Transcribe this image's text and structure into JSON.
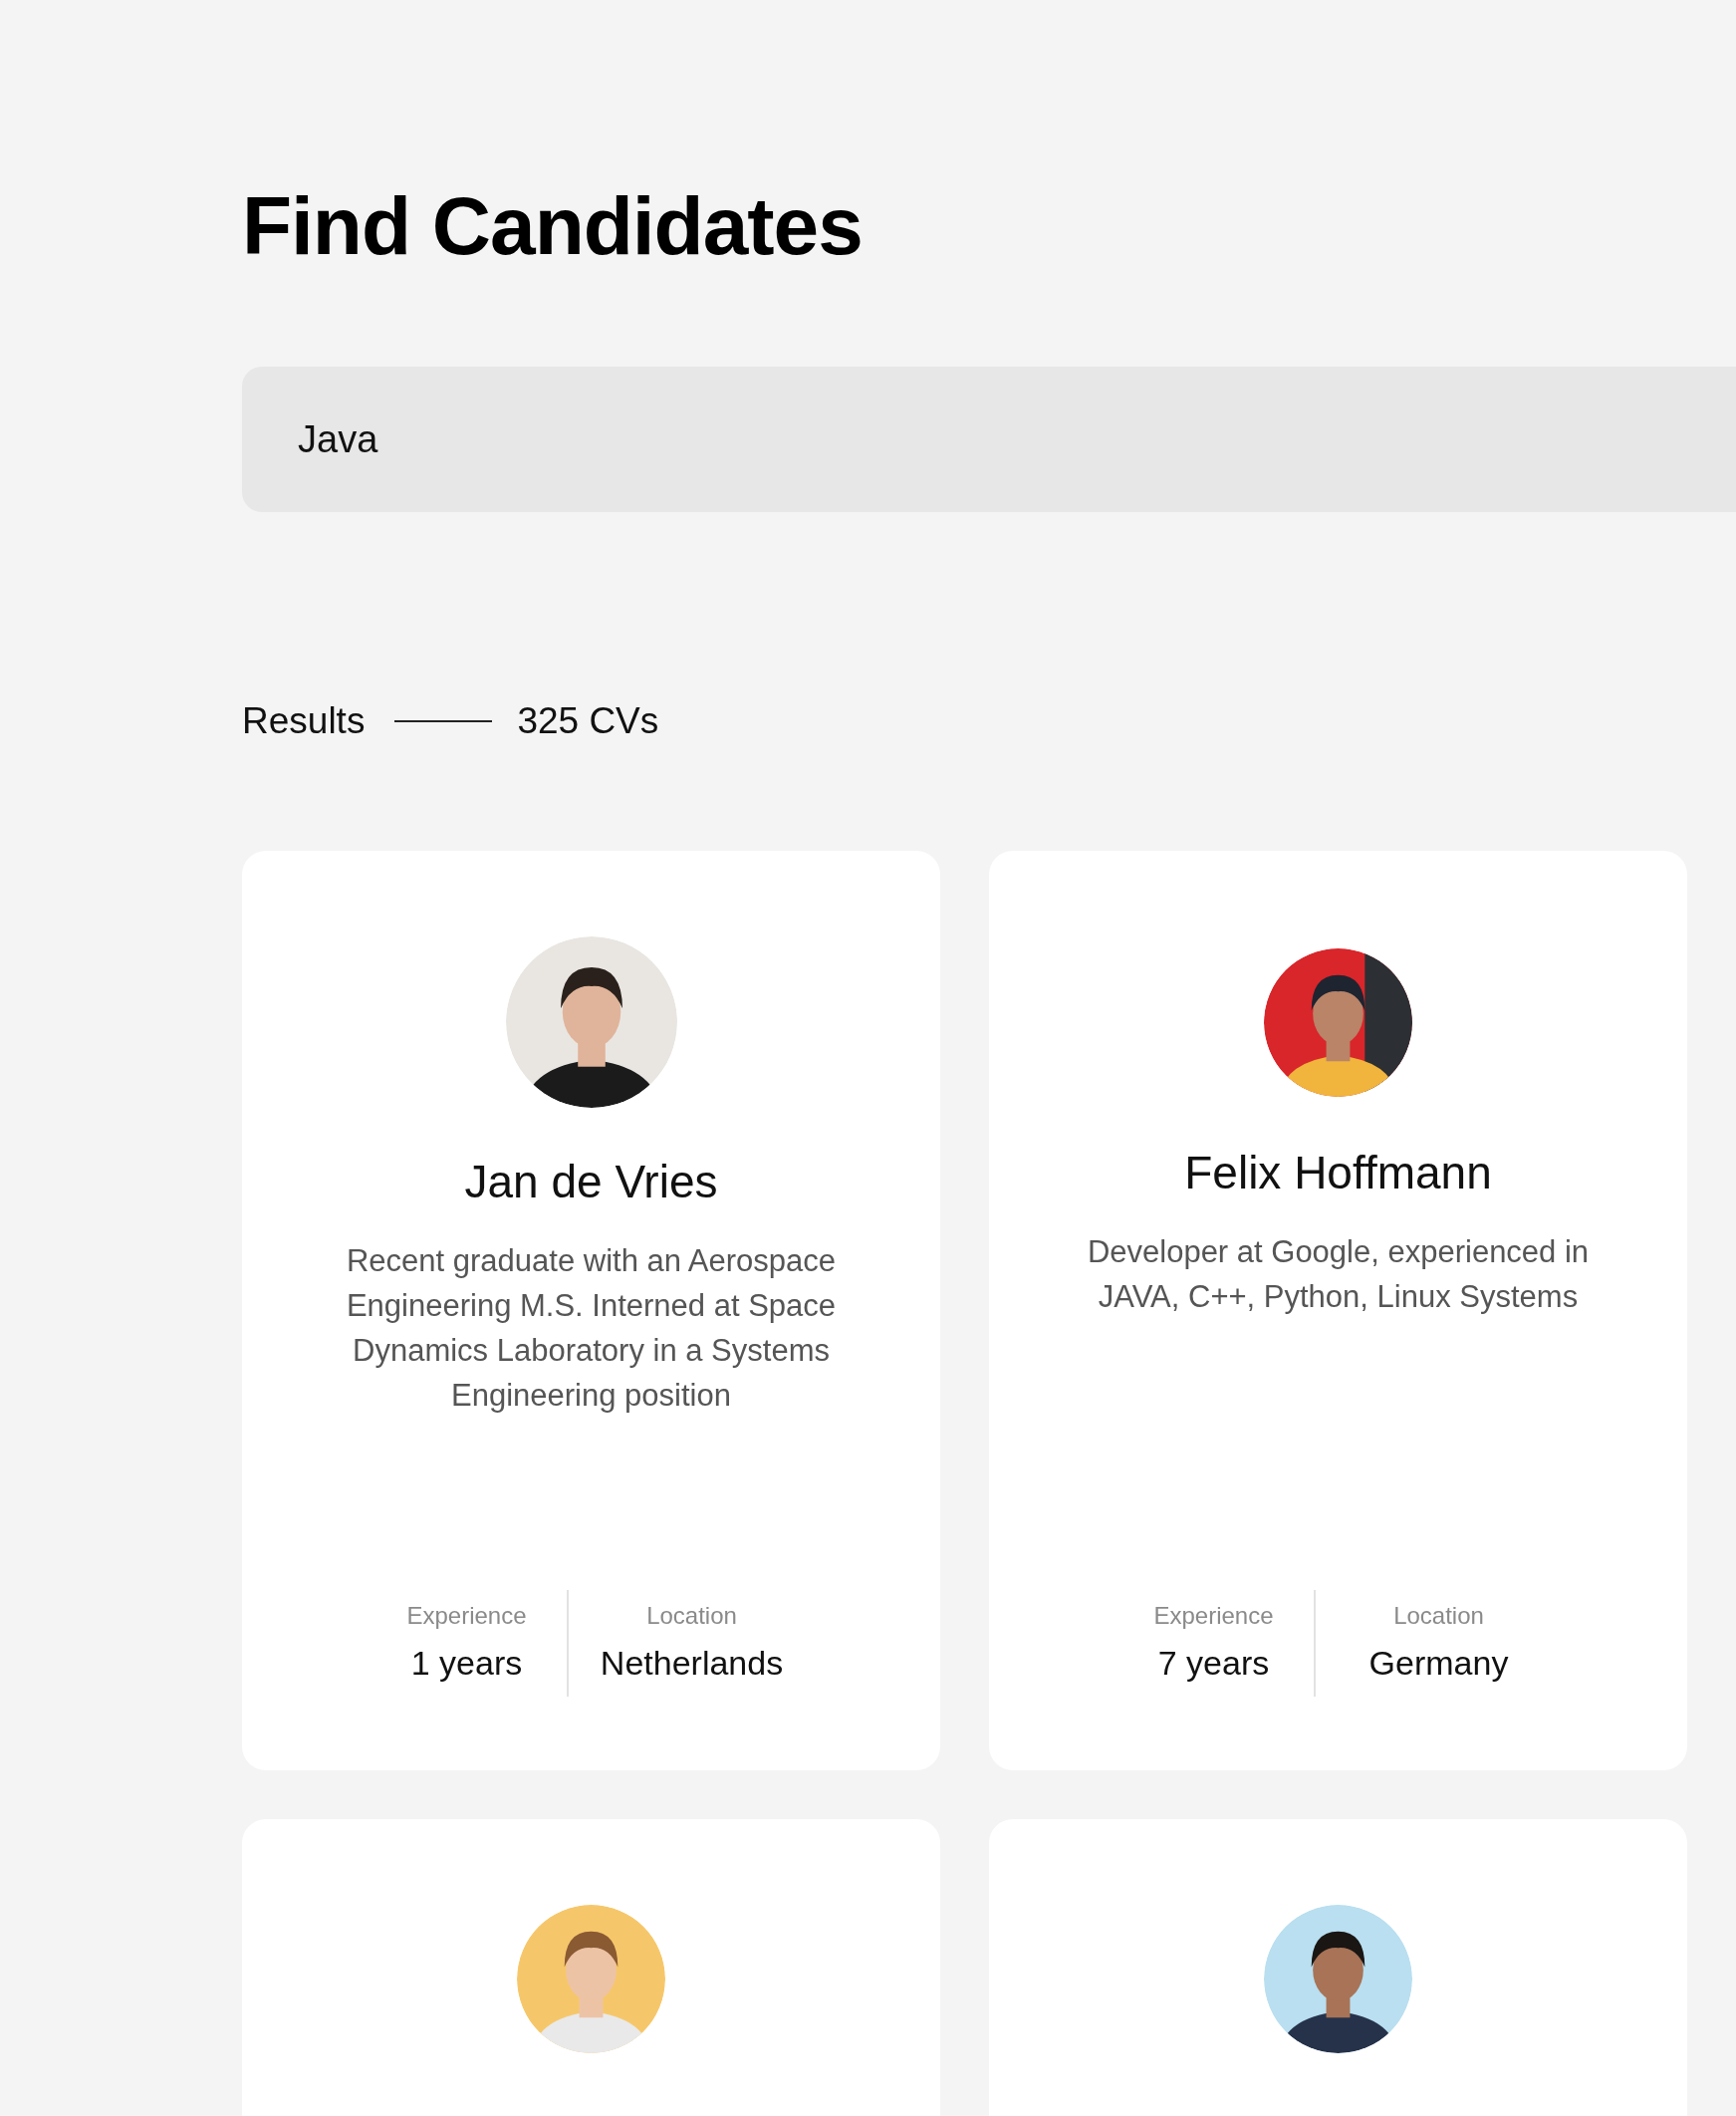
{
  "title": "Find Candidates",
  "search": {
    "value": "Java"
  },
  "results": {
    "label": "Results",
    "count": "325 CVs"
  },
  "candidates": [
    {
      "avatar": {
        "kind": "picture"
      },
      "name": "Jan de Vries",
      "summary": "Recent graduate with an Aerospace Engineering M.S. Interned at Space Dynamics Laboratory in a Systems Engineering position",
      "stats": [
        {
          "label": "Experience",
          "value": "1 years"
        },
        {
          "label": "Location",
          "value": "Netherlands"
        }
      ]
    },
    {
      "avatar": {
        "kind": "picture"
      },
      "name": "Felix Hoffmann",
      "summary": "Developer at Google, experienced in JAVA, C++, Python, Linux Systems",
      "stats": [
        {
          "label": "Experience",
          "value": "7 years"
        },
        {
          "label": "Location",
          "value": "Germany"
        }
      ]
    },
    {
      "avatar": {
        "kind": "picture"
      }
    },
    {
      "avatar": {
        "kind": "picture"
      }
    }
  ]
}
